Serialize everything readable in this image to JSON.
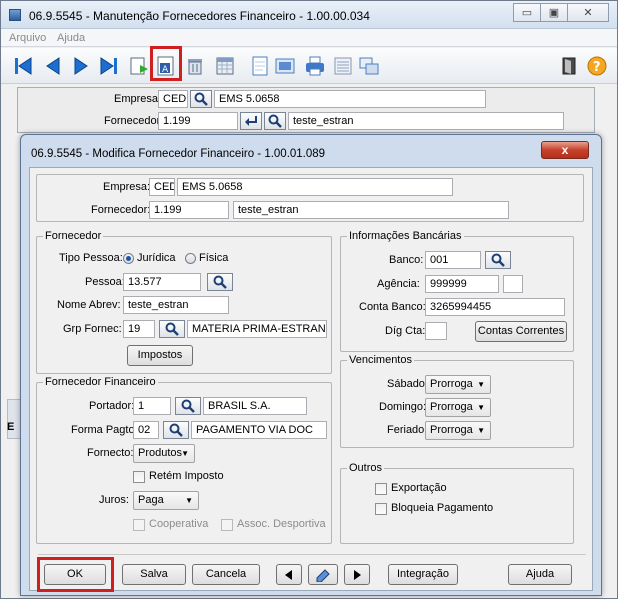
{
  "window": {
    "title": "06.9.5545 - Manutenção Fornecedores Financeiro - 1.00.00.034",
    "controls": {
      "minimize": "▭",
      "maximize": "▣",
      "close": "✕"
    }
  },
  "menu": {
    "items": [
      "Arquivo",
      "Ajuda"
    ]
  },
  "toolbar": {
    "buttons": [
      "first-icon",
      "prev-icon",
      "next-icon",
      "last-icon",
      "add-icon",
      "modify-icon",
      "delete-icon",
      "calendar-icon",
      "copy-doc-icon",
      "zoom-icon",
      "print-icon",
      "list-icon",
      "windows-icon",
      "exit-icon",
      "help-icon"
    ]
  },
  "header": {
    "empresa_label": "Empresa:",
    "empresa_code": "CED",
    "empresa_name": "EMS 5.0658",
    "fornecedor_label": "Fornecedor:",
    "fornecedor_code": "1.199",
    "fornecedor_name": "teste_estran"
  },
  "background_hint": {
    "e_letter": "E"
  },
  "modal": {
    "title": "06.9.5545 - Modifica Fornecedor Financeiro - 1.00.01.089",
    "close": "x",
    "empresa_label": "Empresa:",
    "empresa_code": "CED",
    "empresa_name": "EMS 5.0658",
    "fornecedor_label": "Fornecedor:",
    "fornecedor_code": "1.199",
    "fornecedor_name": "teste_estran",
    "fornecedor_group": {
      "title": "Fornecedor",
      "tipo_pessoa_label": "Tipo Pessoa:",
      "juridica": "Jurídica",
      "fisica": "Física",
      "pessoa_label": "Pessoa:",
      "pessoa_value": "13.577",
      "nome_abrev_label": "Nome Abrev:",
      "nome_abrev_value": "teste_estran",
      "grp_fornec_label": "Grp Fornec:",
      "grp_fornec_code": "19",
      "grp_fornec_name": "MATERIA PRIMA-ESTRAN",
      "impostos_button": "Impostos"
    },
    "financeiro_group": {
      "title": "Fornecedor Financeiro",
      "portador_label": "Portador:",
      "portador_code": "1",
      "portador_name": "BRASIL S.A.",
      "forma_pagto_label": "Forma Pagto:",
      "forma_pagto_code": "02",
      "forma_pagto_name": "PAGAMENTO VIA DOC",
      "fornecto_label": "Fornecto:",
      "fornecto_value": "Produtos",
      "retem_imposto": "Retém Imposto",
      "juros_label": "Juros:",
      "juros_value": "Paga",
      "cooperativa": "Cooperativa",
      "assoc_desportiva": "Assoc. Desportiva"
    },
    "bancarias_group": {
      "title": "Informações Bancárias",
      "banco_label": "Banco:",
      "banco_value": "001",
      "agencia_label": "Agência:",
      "agencia_value": "999999",
      "conta_label": "Conta Banco:",
      "conta_value": "3265994455",
      "dig_cta_label": "Díg Cta:",
      "contas_correntes_button": "Contas Correntes"
    },
    "vencimentos_group": {
      "title": "Vencimentos",
      "sabado_label": "Sábado:",
      "sabado_value": "Prorroga",
      "domingo_label": "Domingo:",
      "domingo_value": "Prorroga",
      "feriado_label": "Feriado:",
      "feriado_value": "Prorroga"
    },
    "outros_group": {
      "title": "Outros",
      "exportacao": "Exportação",
      "bloqueia_pagamento": "Bloqueia Pagamento"
    },
    "footer": {
      "ok": "OK",
      "salva": "Salva",
      "cancela": "Cancela",
      "integracao": "Integração",
      "ajuda": "Ajuda"
    }
  }
}
